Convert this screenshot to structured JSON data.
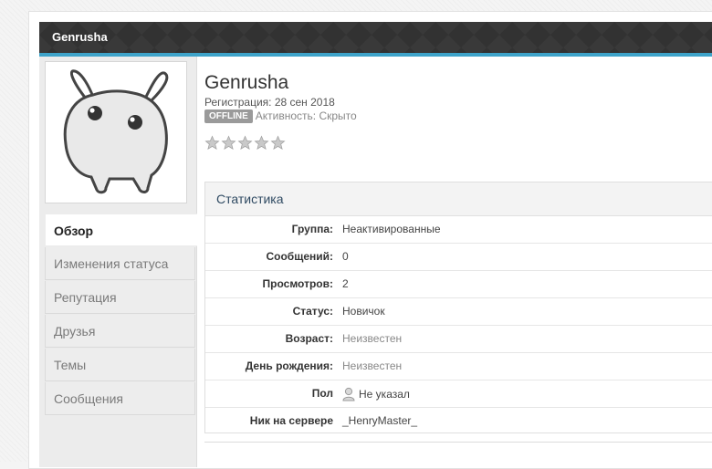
{
  "titlebar": {
    "title": "Genrusha"
  },
  "profile": {
    "name": "Genrusha",
    "registration": "Регистрация: 28 сен 2018",
    "status_badge": "OFFLINE",
    "activity": "Активность: Скрыто",
    "rating_stars": 5,
    "rating_value": 0
  },
  "tabs": [
    {
      "label": "Обзор",
      "active": true
    },
    {
      "label": "Изменения статуса"
    },
    {
      "label": "Репутация"
    },
    {
      "label": "Друзья"
    },
    {
      "label": "Темы"
    },
    {
      "label": "Сообщения"
    }
  ],
  "stats": {
    "title": "Статистика",
    "rows": [
      {
        "label": "Группа:",
        "value": "Неактивированные"
      },
      {
        "label": "Сообщений:",
        "value": "0"
      },
      {
        "label": "Просмотров:",
        "value": "2"
      },
      {
        "label": "Статус:",
        "value": "Новичок"
      },
      {
        "label": "Возраст:",
        "value": "Неизвестен"
      },
      {
        "label": "День рождения:",
        "value": "Неизвестен"
      },
      {
        "label": "Пол",
        "value": "Не указал",
        "icon": "user-icon"
      },
      {
        "label": "Ник на сервере",
        "value": "_HenryMaster_"
      }
    ]
  },
  "colors": {
    "accent": "#3ea3c9",
    "titlebar": "#323232",
    "badge": "#9a9a9a"
  }
}
